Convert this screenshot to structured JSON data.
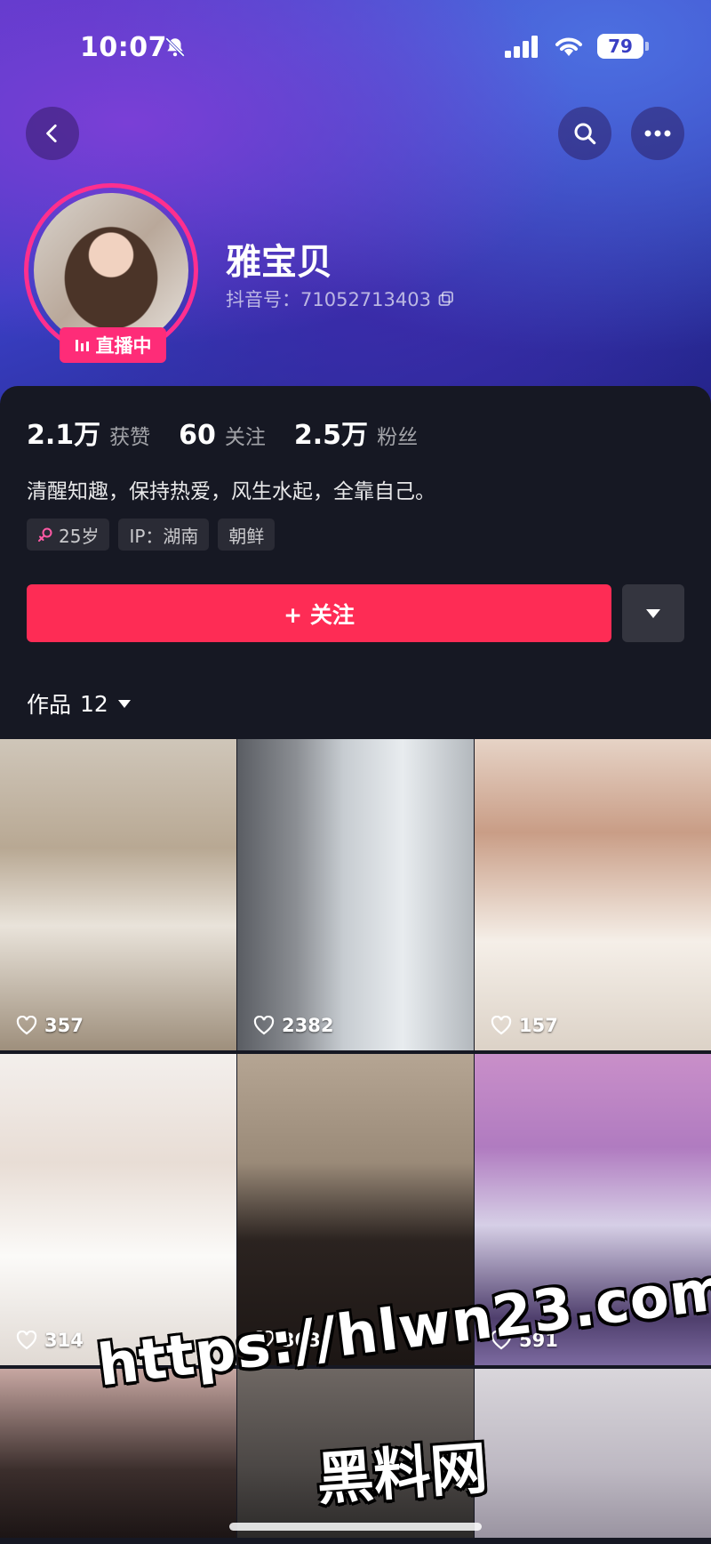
{
  "status_bar": {
    "time": "10:07",
    "battery": "79"
  },
  "profile": {
    "live_badge": "直播中",
    "nickname": "雅宝贝",
    "douyin_id": "抖音号：71052713403"
  },
  "stats": [
    {
      "value": "2.1万",
      "label": "获赞"
    },
    {
      "value": "60",
      "label": "关注"
    },
    {
      "value": "2.5万",
      "label": "粉丝"
    }
  ],
  "bio": "清醒知趣，保持热爱，风生水起，全靠自己。",
  "tags": [
    "25岁",
    "IP：湖南",
    "朝鲜"
  ],
  "follow_button": "+ 关注",
  "works": {
    "label": "作品",
    "count": "12"
  },
  "grid_likes": [
    "357",
    "2382",
    "157",
    "314",
    "303",
    "591"
  ],
  "watermark": {
    "url": "https://hlwn23.com",
    "name": "黑料网"
  },
  "colors": {
    "accent": "#fe2c55",
    "live": "#fe2c78",
    "background": "#161823"
  }
}
